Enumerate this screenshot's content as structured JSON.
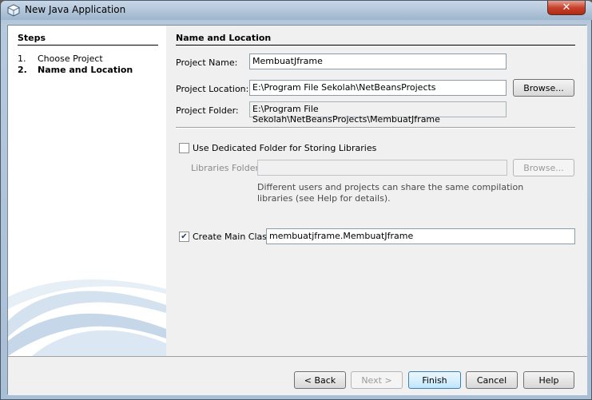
{
  "window": {
    "title": "New Java Application",
    "close_label": "✕"
  },
  "steps": {
    "title": "Steps",
    "items": [
      {
        "num": "1.",
        "label": "Choose Project",
        "current": false
      },
      {
        "num": "2.",
        "label": "Name and Location",
        "current": true
      }
    ]
  },
  "main": {
    "title": "Name and Location",
    "project_name": {
      "label": "Project Name:",
      "value": "MembuatJframe"
    },
    "project_location": {
      "label": "Project Location:",
      "value": "E:\\Program File Sekolah\\NetBeansProjects",
      "browse_label": "Browse..."
    },
    "project_folder": {
      "label": "Project Folder:",
      "value": "E:\\Program File Sekolah\\NetBeansProjects\\MembuatJframe"
    },
    "dedicated_folder": {
      "label": "Use Dedicated Folder for Storing Libraries",
      "checked": false
    },
    "libraries_folder": {
      "label": "Libraries Folder:",
      "value": "",
      "browse_label": "Browse..."
    },
    "libraries_note_line1": "Different users and projects can share the same compilation",
    "libraries_note_line2": "libraries (see Help for details).",
    "create_main_class": {
      "label": "Create Main Class",
      "checked": true,
      "value": "membuatjframe.MembuatJframe"
    }
  },
  "footer": {
    "back_label": "< Back",
    "next_label": "Next >",
    "finish_label": "Finish",
    "cancel_label": "Cancel",
    "help_label": "Help"
  },
  "colors": {
    "titlebar": "#9eb5cd",
    "close": "#c7432d",
    "panel": "#f0f0f0",
    "default_button": "#bee6fd"
  }
}
